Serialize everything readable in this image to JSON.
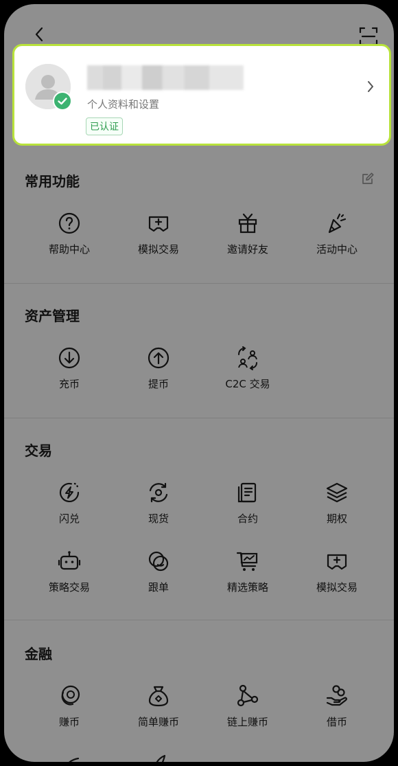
{
  "profile": {
    "subtitle": "个人资料和设置",
    "verified_label": "已认证"
  },
  "sections": {
    "common": {
      "title": "常用功能",
      "items": [
        {
          "label": "帮助中心",
          "icon": "help-circle-icon"
        },
        {
          "label": "模拟交易",
          "icon": "gamepad-icon"
        },
        {
          "label": "邀请好友",
          "icon": "gift-icon"
        },
        {
          "label": "活动中心",
          "icon": "party-popper-icon"
        }
      ]
    },
    "assets": {
      "title": "资产管理",
      "items": [
        {
          "label": "充币",
          "icon": "deposit-icon"
        },
        {
          "label": "提币",
          "icon": "withdraw-icon"
        },
        {
          "label": "C2C 交易",
          "icon": "p2p-exchange-icon"
        }
      ]
    },
    "trade": {
      "title": "交易",
      "items": [
        {
          "label": "闪兑",
          "icon": "flash-convert-icon"
        },
        {
          "label": "现货",
          "icon": "spot-icon"
        },
        {
          "label": "合约",
          "icon": "contract-icon"
        },
        {
          "label": "期权",
          "icon": "options-layers-icon"
        },
        {
          "label": "策略交易",
          "icon": "robot-icon"
        },
        {
          "label": "跟单",
          "icon": "copy-trading-icon"
        },
        {
          "label": "精选策略",
          "icon": "chart-cart-icon"
        },
        {
          "label": "模拟交易",
          "icon": "gamepad-icon"
        }
      ]
    },
    "finance": {
      "title": "金融",
      "items": [
        {
          "label": "赚币",
          "icon": "coins-icon"
        },
        {
          "label": "简单赚币",
          "icon": "money-bag-icon"
        },
        {
          "label": "链上赚币",
          "icon": "molecule-icon"
        },
        {
          "label": "借币",
          "icon": "hand-coin-icon"
        }
      ]
    }
  }
}
